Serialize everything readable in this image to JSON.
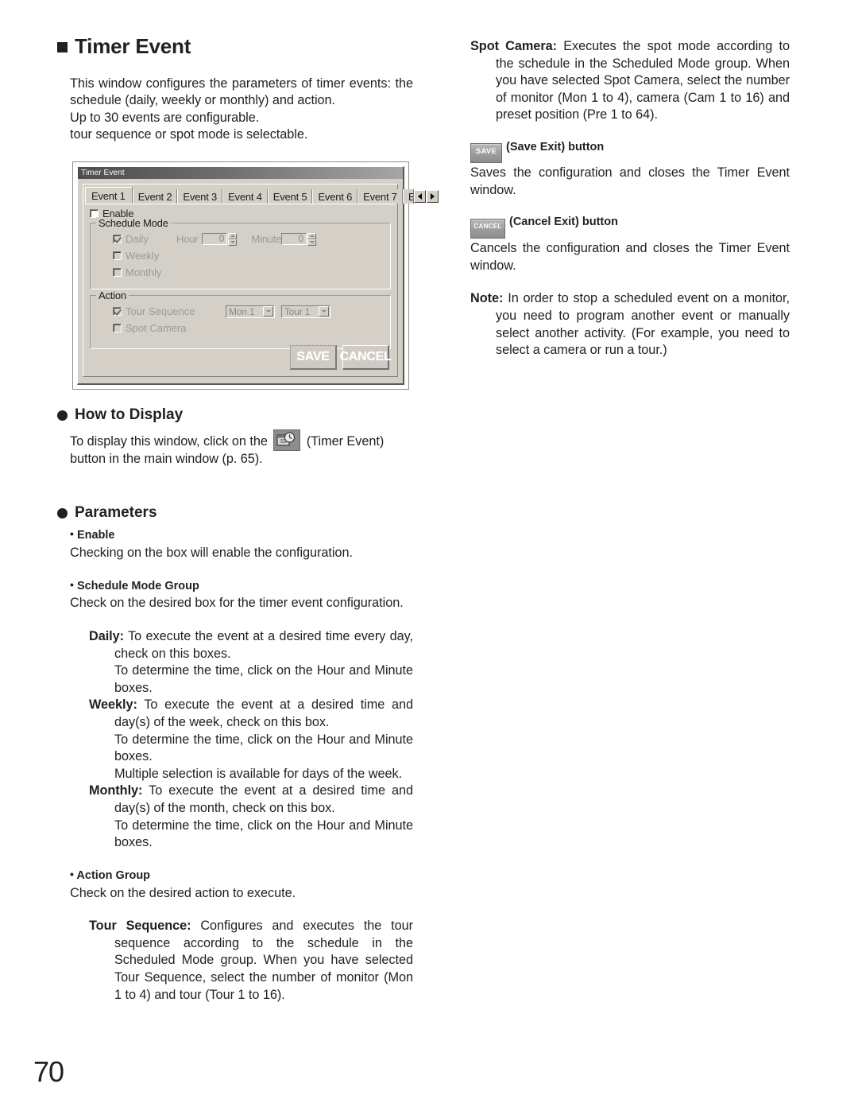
{
  "page": {
    "number": "70"
  },
  "left": {
    "title": "Timer Event",
    "intro_p1": "This window configures the parameters of timer events:  the schedule (daily, weekly or monthly) and action.",
    "intro_p2": "Up to 30 events are configurable.",
    "intro_p3": "tour sequence or spot mode is selectable.",
    "how_to_display": {
      "heading": "How to Display",
      "text_before_icon": "To display this window, click on the",
      "icon_name": "timer-event-icon",
      "text_after_icon": "(Timer Event) button in the main window (p. 65)."
    },
    "parameters": {
      "heading": "Parameters",
      "items": [
        {
          "label": "Enable",
          "body": "Checking on the box will enable the configuration."
        },
        {
          "label": "Schedule Mode Group",
          "body": "Check on the desired box for the timer event configuration."
        },
        {
          "label": "Action Group",
          "body": "Check on the desired action to execute."
        }
      ],
      "schedule_modes": [
        {
          "term": "Daily:",
          "desc": "To execute the event at a desired time every day, check on this boxes.",
          "extra": [
            "To determine the time, click on the Hour and Minute boxes."
          ]
        },
        {
          "term": "Weekly:",
          "desc": "To execute the event at a desired time and day(s) of the week, check on this box.",
          "extra": [
            "To determine the time, click on the Hour and Minute boxes.",
            "Multiple selection is available for days of the week."
          ]
        },
        {
          "term": "Monthly:",
          "desc": "To execute the event at a desired time and day(s) of the month, check on this box.",
          "extra": [
            "To determine the time, click on the Hour and Minute boxes."
          ]
        }
      ],
      "actions": [
        {
          "term": "Tour Sequence:",
          "desc": "Configures and executes the tour sequence according to the schedule in the Scheduled Mode group. When you have selected Tour Sequence, select the number of monitor (Mon 1 to 4) and tour (Tour 1 to 16)."
        }
      ]
    }
  },
  "right": {
    "spot_camera": {
      "term": "Spot Camera:",
      "desc": "Executes the spot mode according to the schedule in the Scheduled Mode group. When you have selected Spot Camera, select the number of monitor (Mon 1 to 4), camera (Cam 1 to 16) and preset position (Pre 1 to 64)."
    },
    "save_exit": {
      "badge": "SAVE",
      "heading": "(Save Exit) button",
      "body": "Saves the configuration and closes the Timer Event window."
    },
    "cancel_exit": {
      "badge": "CANCEL",
      "heading": "(Cancel Exit) button",
      "body": "Cancels the configuration and closes the Timer Event window."
    },
    "note": {
      "term": "Note:",
      "body": "In order to stop a scheduled event on a monitor, you need to program another event or manually select another activity. (For example, you need to select a camera or run a tour.)"
    }
  },
  "dialog": {
    "title": "Timer Event",
    "tabs": [
      "Event 1",
      "Event 2",
      "Event 3",
      "Event 4",
      "Event 5",
      "Event 6",
      "Event 7",
      "Ever"
    ],
    "scroll_left_icon": "triangle-left-icon",
    "scroll_right_icon": "triangle-right-icon",
    "enable_label": "Enable",
    "schedule_group": {
      "legend": "Schedule Mode",
      "daily_label": "Daily",
      "weekly_label": "Weekly",
      "monthly_label": "Monthly",
      "hour_label": "Hour",
      "hour_value": "0",
      "minute_label": "Minute",
      "minute_value": "0"
    },
    "action_group": {
      "legend": "Action",
      "tour_sequence_label": "Tour Sequence",
      "spot_camera_label": "Spot Camera",
      "monitor_value": "Mon 1",
      "tour_value": "Tour 1"
    },
    "save_button": "SAVE",
    "cancel_button": "CANCEL"
  }
}
